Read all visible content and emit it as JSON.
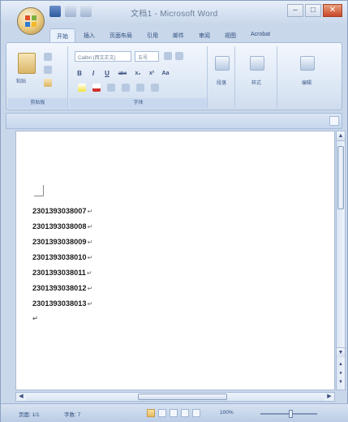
{
  "window": {
    "title": "文档1 - Microsoft Word",
    "controls": {
      "minimize": "–",
      "maximize": "□",
      "close": "✕"
    }
  },
  "tabs": [
    "开始",
    "插入",
    "页面布局",
    "引用",
    "邮件",
    "审阅",
    "视图",
    "Acrobat"
  ],
  "ribbon": {
    "clipboard": {
      "paste_label": "粘贴",
      "group_label": "剪贴板"
    },
    "font": {
      "font_name": "Calibri (西文正文)",
      "font_size": "五号",
      "group_label": "字体",
      "format_buttons": [
        "B",
        "I",
        "U",
        "abe",
        "x₂",
        "x²",
        "Aa"
      ]
    },
    "paragraph": {
      "label": "段落"
    },
    "styles": {
      "label": "样式"
    },
    "editing": {
      "label": "编辑"
    }
  },
  "document": {
    "lines": [
      "2301393038007",
      "2301393038008",
      "2301393038009",
      "2301393038010",
      "2301393038011",
      "2301393038012",
      "2301393038013"
    ],
    "paragraph_mark": "↵"
  },
  "statusbar": {
    "page": "页面: 1/1",
    "words": "字数: 7",
    "zoom": "100%"
  },
  "colors": {
    "ribbon_bg": "#dbe6f4",
    "window_frame": "#c9d7ea",
    "close_button": "#c8462a"
  }
}
